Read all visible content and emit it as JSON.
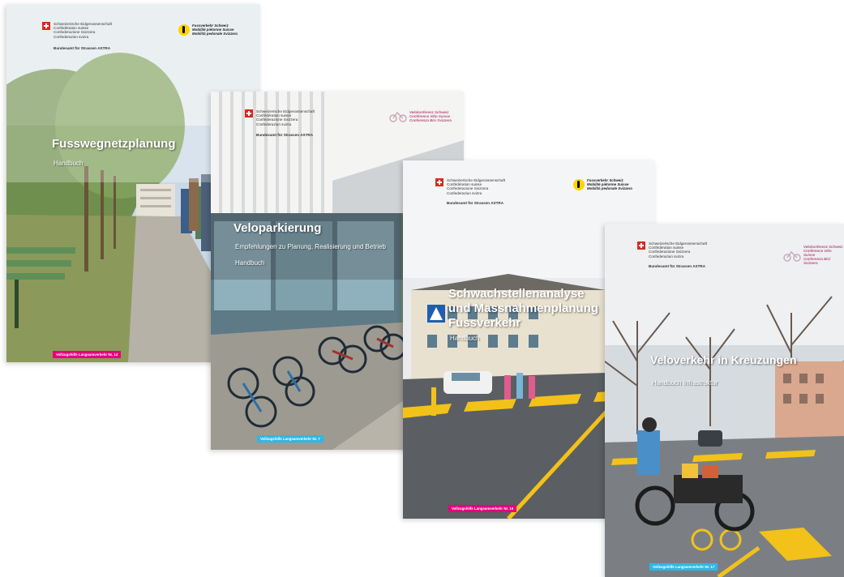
{
  "federal": {
    "lines": [
      "Schweizerische Eidgenossenschaft",
      "Confédération suisse",
      "Confederazione Svizzera",
      "Confederaziun svizra"
    ],
    "office": "Bundesamt für Strassen ASTRA"
  },
  "partners": {
    "pedestrian": [
      "Fussverkehr Schweiz",
      "Mobilité piétonne Suisse",
      "Mobilità pedonale Svizzera"
    ],
    "cycling": [
      "Velokonferenz Schweiz",
      "Conférence Vélo Suisse",
      "Conferenza Bici Svizzera"
    ]
  },
  "colors": {
    "magenta": "#e5007d",
    "cyan": "#2fb7e9"
  },
  "covers": [
    {
      "title": "Fusswegnetzplanung",
      "subtitle": "Handbuch",
      "series": "Vollzugshilfe Langsamverkehr Nr. 14"
    },
    {
      "title": "Veloparkierung",
      "subtitle": "Empfehlungen zu Planung, Realisierung und Betrieb",
      "subtitle2": "Handbuch",
      "series": "Vollzugshilfe Langsamverkehr Nr. 7"
    },
    {
      "title_lines": [
        "Schwachstellenanalyse",
        "und Massnahmenplanung",
        "Fussverkehr"
      ],
      "subtitle": "Handbuch",
      "series": "Vollzugshilfe Langsamverkehr Nr. 16"
    },
    {
      "title": "Veloverkehr in Kreuzungen",
      "subtitle": "Handbuch Infrastruktur",
      "series": "Vollzugshilfe Langsamverkehr Nr. 17"
    }
  ]
}
